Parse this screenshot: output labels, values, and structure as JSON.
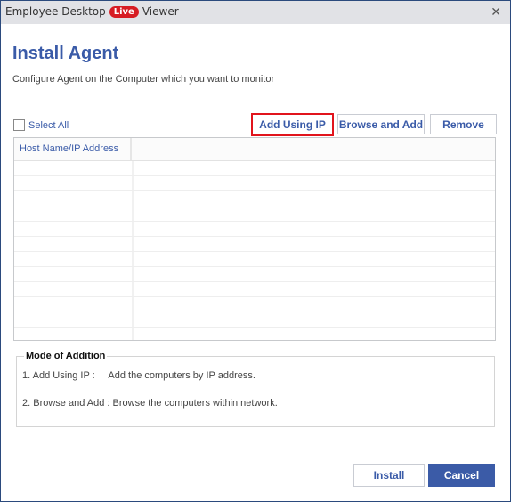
{
  "window": {
    "title_prefix": "Employee Desktop",
    "title_badge": "Live",
    "title_suffix": "Viewer",
    "close_glyph": "✕"
  },
  "header": {
    "title": "Install Agent",
    "subtitle": "Configure Agent on the Computer which you want to monitor"
  },
  "toolbar": {
    "select_all_label": "Select All",
    "select_all_checked": false,
    "add_using_ip_label": "Add Using IP",
    "browse_and_add_label": "Browse and Add",
    "remove_label": "Remove"
  },
  "table": {
    "columns": [
      "Host Name/IP Address",
      ""
    ],
    "rows": []
  },
  "mode_of_addition": {
    "title": "Mode of Addition",
    "items": [
      "1. Add Using IP :     Add the computers by IP address.",
      "2. Browse and Add : Browse the computers within network."
    ]
  },
  "footer": {
    "install_label": "Install",
    "cancel_label": "Cancel"
  },
  "colors": {
    "accent": "#3b5ba7",
    "highlight": "#e1141c",
    "badge": "#d71d24"
  }
}
